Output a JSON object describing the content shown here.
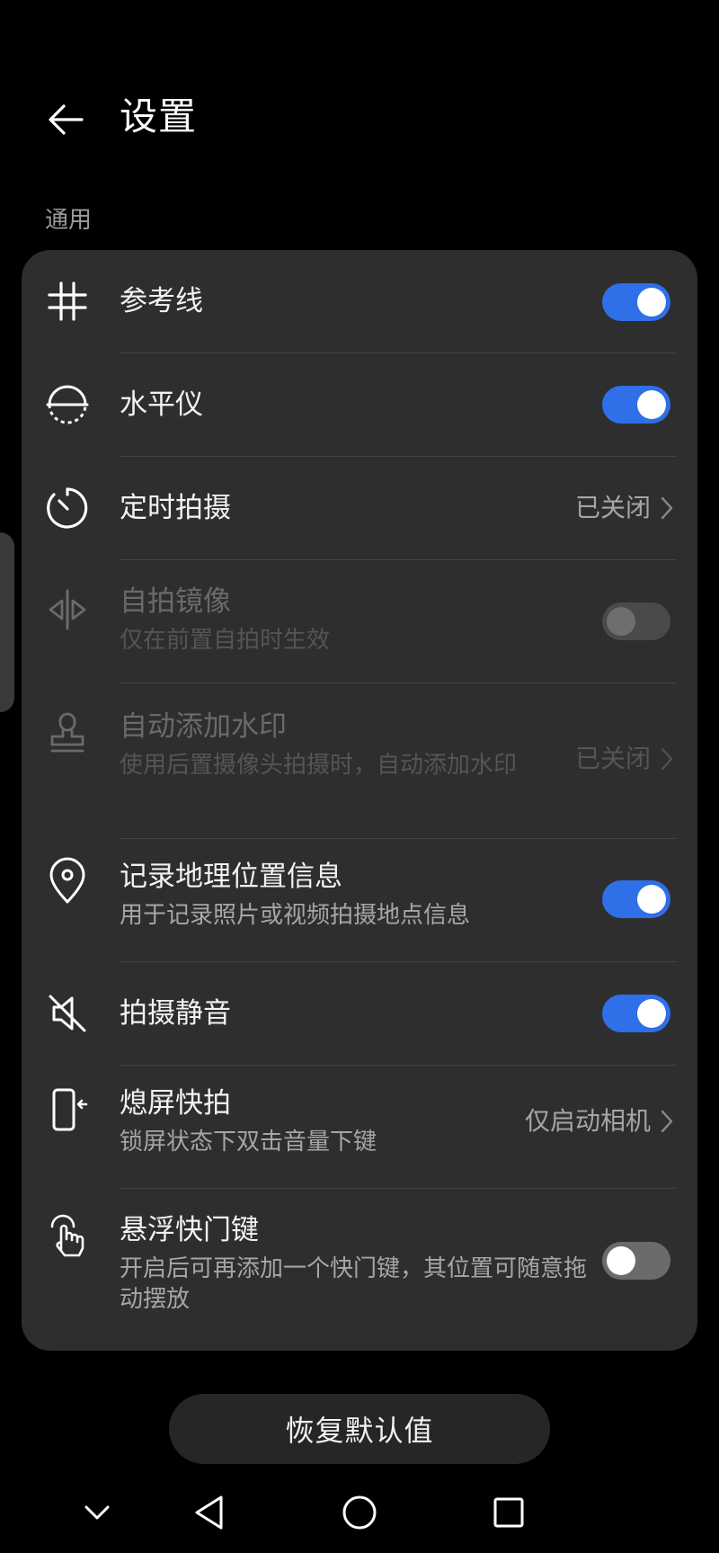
{
  "header": {
    "title": "设置"
  },
  "section": {
    "label": "通用"
  },
  "settings": [
    {
      "label": "参考线",
      "control": "toggle",
      "state": "on",
      "icon": "grid-icon"
    },
    {
      "label": "水平仪",
      "control": "toggle",
      "state": "on",
      "icon": "level-icon"
    },
    {
      "label": "定时拍摄",
      "control": "link",
      "value": "已关闭",
      "icon": "timer-icon"
    },
    {
      "label": "自拍镜像",
      "sublabel": "仅在前置自拍时生效",
      "control": "toggle",
      "state": "off",
      "disabled": true,
      "icon": "mirror-icon"
    },
    {
      "label": "自动添加水印",
      "sublabel": "使用后置摄像头拍摄时，自动添加水印",
      "control": "link",
      "value": "已关闭",
      "disabled": true,
      "icon": "stamp-icon"
    },
    {
      "label": "记录地理位置信息",
      "sublabel": "用于记录照片或视频拍摄地点信息",
      "control": "toggle",
      "state": "on",
      "icon": "location-pin-icon"
    },
    {
      "label": "拍摄静音",
      "control": "toggle",
      "state": "on",
      "icon": "mute-icon"
    },
    {
      "label": "熄屏快拍",
      "sublabel": "锁屏状态下双击音量下键",
      "control": "link",
      "value": "仅启动相机",
      "icon": "phone-volume-icon"
    },
    {
      "label": "悬浮快门键",
      "sublabel": "开启后可再添加一个快门键，其位置可随意拖动摆放",
      "control": "toggle",
      "state": "off",
      "icon": "touch-icon"
    }
  ],
  "reset_button": {
    "label": "恢复默认值"
  },
  "navbar": {
    "items": [
      "collapse-icon",
      "back-triangle-icon",
      "home-circle-icon",
      "recents-square-icon"
    ]
  },
  "colors": {
    "accent": "#2f6fe8",
    "card": "#2e2e2e",
    "background": "#000000"
  }
}
